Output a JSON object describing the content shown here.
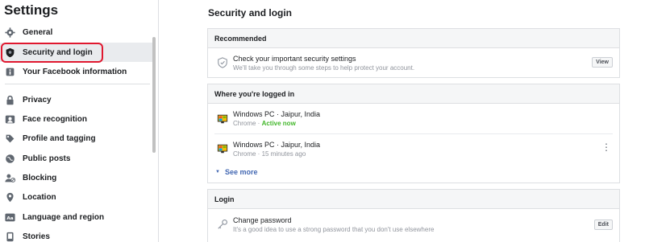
{
  "sidebar": {
    "title": "Settings",
    "items": [
      {
        "label": "General",
        "icon": "gear-icon"
      },
      {
        "label": "Security and login",
        "icon": "shield-icon"
      },
      {
        "label": "Your Facebook information",
        "icon": "facebook-info-icon"
      },
      {
        "label": "Privacy",
        "icon": "lock-icon"
      },
      {
        "label": "Face recognition",
        "icon": "face-recognition-icon"
      },
      {
        "label": "Profile and tagging",
        "icon": "tag-icon"
      },
      {
        "label": "Public posts",
        "icon": "globe-icon"
      },
      {
        "label": "Blocking",
        "icon": "blocking-icon"
      },
      {
        "label": "Location",
        "icon": "location-pin-icon"
      },
      {
        "label": "Language and region",
        "icon": "language-icon"
      },
      {
        "label": "Stories",
        "icon": "stories-icon"
      }
    ]
  },
  "main": {
    "page_title": "Security and login",
    "recommended": {
      "header": "Recommended",
      "title": "Check your important security settings",
      "subtitle": "We'll take you through some steps to help protect your account.",
      "button": "View"
    },
    "logged_in": {
      "header": "Where you're logged in",
      "sessions": [
        {
          "device": "Windows PC · Jaipur, India",
          "browser": "Chrome · ",
          "status": "Active now"
        },
        {
          "device": "Windows PC · Jaipur, India",
          "browser": "Chrome · 15 minutes ago",
          "status": ""
        }
      ],
      "see_more": "See more"
    },
    "login": {
      "header": "Login",
      "title": "Change password",
      "subtitle": "It's a good idea to use a strong password that you don't use elsewhere",
      "button": "Edit"
    }
  },
  "colors": {
    "highlight": "#e0182f",
    "active_status": "#42b72a",
    "link": "#4267b2"
  }
}
